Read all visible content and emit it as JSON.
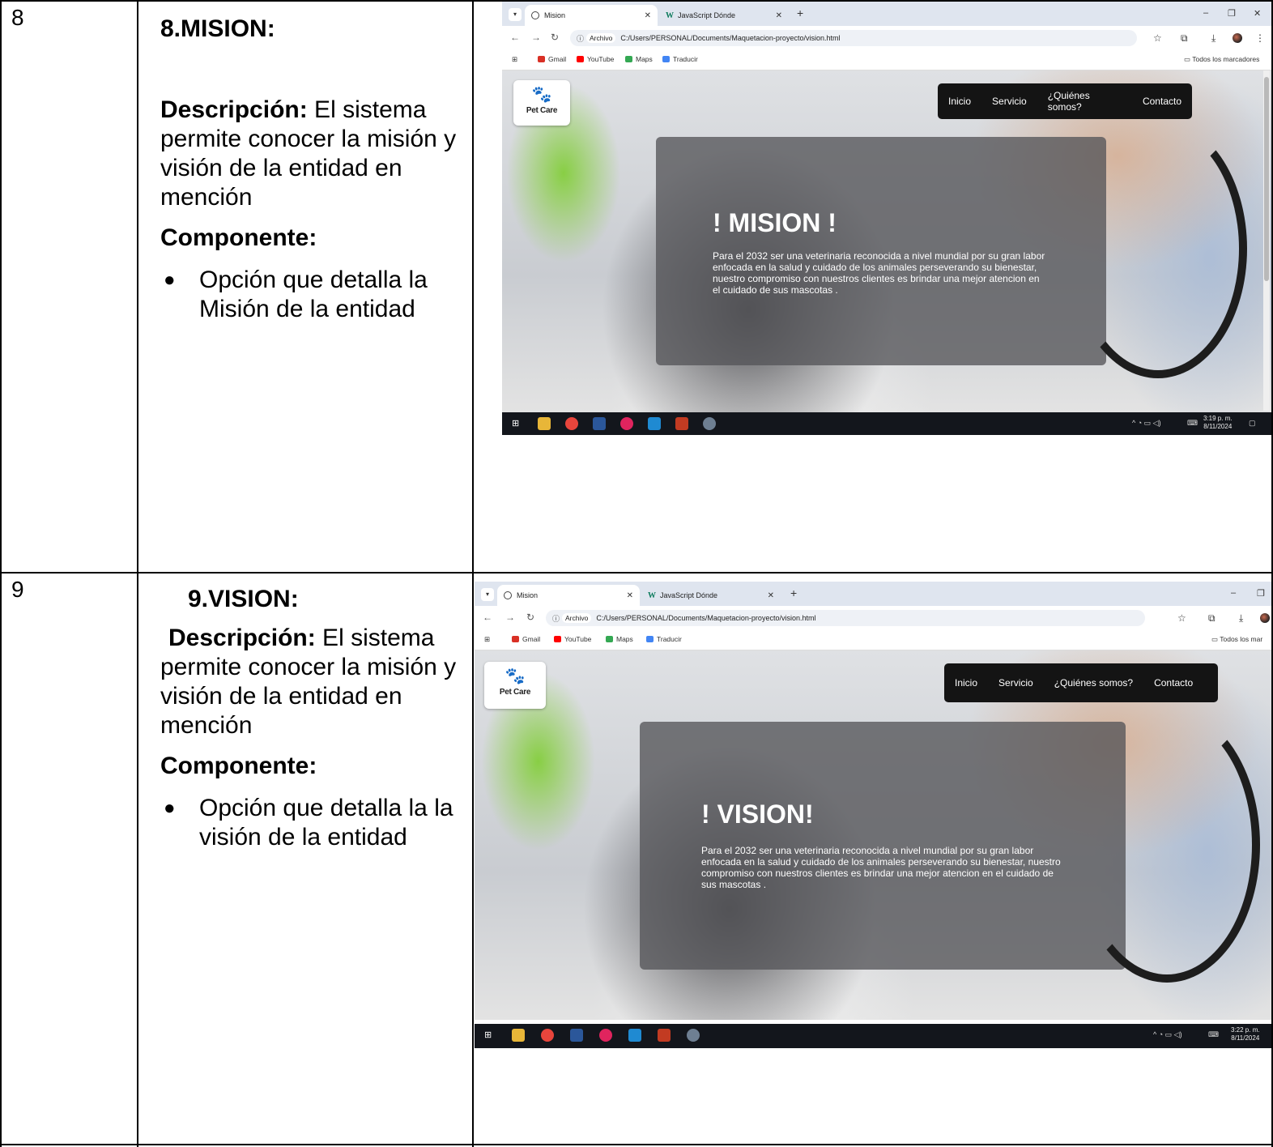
{
  "rows": [
    {
      "number": "8",
      "heading": "8.MISION:",
      "description_label": "Descripción:",
      "description_text": " El sistema permite conocer la misión y visión de la entidad en mención",
      "component_label": "Componente:",
      "component_items": [
        "Opción que detalla la Misión de la entidad"
      ],
      "screenshot": {
        "tabs": [
          "Mision",
          "JavaScript Dónde"
        ],
        "url_scheme": "Archivo",
        "url": "C:/Users/PERSONAL/Documents/Maquetacion-proyecto/vision.html",
        "bookmarks": [
          "Gmail",
          "YouTube",
          "Maps",
          "Traducir"
        ],
        "all_bookmarks": "Todos los marcadores",
        "logo_text": "Pet Care",
        "nav": [
          "Inicio",
          "Servicio",
          "¿Quiénes somos?",
          "Contacto"
        ],
        "panel_title": "! MISION !",
        "panel_text": "Para el 2032 ser una veterinaria reconocida a nivel mundial por su gran labor enfocada en la salud y cuidado de los animales perseverando su bienestar, nuestro compromiso con nuestros clientes es brindar una mejor atencion en el cuidado de sus mascotas .",
        "clock_time": "3:19 p. m.",
        "clock_date": "8/11/2024"
      }
    },
    {
      "number": "9",
      "heading": "9.VISION:",
      "description_label": "Descripción:",
      "description_text": " El sistema permite conocer la misión y visión de la entidad en mención",
      "component_label": "Componente:",
      "component_items": [
        "Opción que detalla la la visión  de la entidad"
      ],
      "screenshot": {
        "tabs": [
          "Mision",
          "JavaScript Dónde"
        ],
        "url_scheme": "Archivo",
        "url": "C:/Users/PERSONAL/Documents/Maquetacion-proyecto/vision.html",
        "bookmarks": [
          "Gmail",
          "YouTube",
          "Maps",
          "Traducir"
        ],
        "all_bookmarks": "Todos los mar",
        "logo_text": "Pet Care",
        "nav": [
          "Inicio",
          "Servicio",
          "¿Quiénes somos?",
          "Contacto"
        ],
        "panel_title": "! VISION!",
        "panel_text": "Para el 2032 ser una veterinaria reconocida a nivel mundial por su gran labor enfocada en la salud y cuidado de los animales perseverando su bienestar, nuestro compromiso con nuestros clientes es brindar una mejor atencion en el cuidado de sus mascotas .",
        "clock_time": "3:22 p. m.",
        "clock_date": "8/11/2024"
      }
    }
  ],
  "icons": {
    "bullet": "bullet-icon",
    "tab_favicon": "globe-icon",
    "back": "arrow-left-icon",
    "forward": "arrow-right-icon",
    "reload": "reload-icon",
    "star": "star-icon",
    "extensions": "puzzle-icon",
    "download": "download-icon"
  },
  "colors": {
    "tab_strip": "#dfe5ef",
    "nav_bar": "#141414",
    "panel": "#555558",
    "taskbar": "#13161c",
    "leaf_green": "#84ce3c"
  }
}
